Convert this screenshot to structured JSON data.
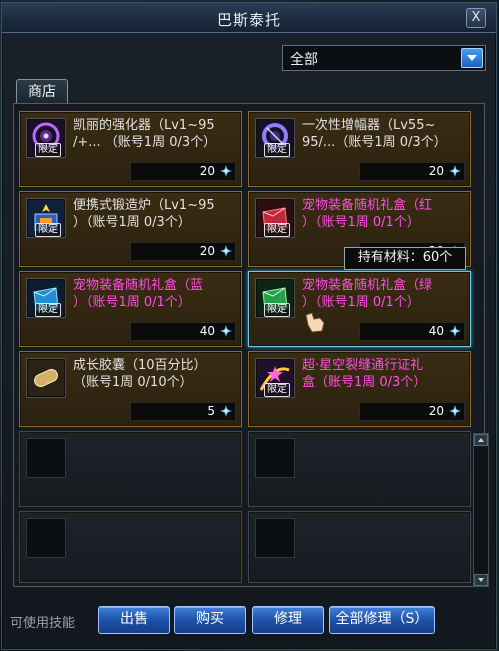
{
  "window": {
    "title": "巴斯泰托",
    "close_label": "X"
  },
  "filter": {
    "selected": "全部"
  },
  "tab": {
    "label": "商店"
  },
  "badge_label": "限定",
  "items": [
    {
      "name_line1": "凯丽的强化器（Lv1~95",
      "name_line2": "/+... （账号1周 0/3个）",
      "price": "20",
      "color": "white",
      "icon": "purple-orb-icon",
      "limited": true
    },
    {
      "name_line1": "一次性增幅器（Lv55~",
      "name_line2": "95/...（账号1周 0/3个）",
      "price": "20",
      "color": "white",
      "icon": "purple-ring-icon",
      "limited": true
    },
    {
      "name_line1": "便携式锻造炉（Lv1~95",
      "name_line2": "）（账号1周 0/3个）",
      "price": "20",
      "color": "white",
      "icon": "forge-icon",
      "limited": true
    },
    {
      "name_line1": "宠物装备随机礼盒（红",
      "name_line2": "）（账号1周 0/1个）",
      "price": "20",
      "color": "pink",
      "icon": "red-gift-box-icon",
      "limited": true
    },
    {
      "name_line1": "宠物装备随机礼盒（蓝",
      "name_line2": "）（账号1周 0/1个）",
      "price": "40",
      "color": "pink",
      "icon": "blue-gift-box-icon",
      "limited": true
    },
    {
      "name_line1": "宠物装备随机礼盒（绿",
      "name_line2": "）（账号1周 0/1个）",
      "price": "40",
      "color": "pink",
      "icon": "green-gift-box-icon",
      "limited": true,
      "selected": true
    },
    {
      "name_line1": "成长胶囊（10百分比）",
      "name_line2": "（账号1周 0/10个）",
      "price": "5",
      "color": "white",
      "icon": "capsule-icon",
      "limited": false
    },
    {
      "name_line1": "超·星空裂缝通行证礼",
      "name_line2": "盒（账号1周 0/3个）",
      "price": "20",
      "color": "pink",
      "icon": "star-pass-icon",
      "limited": true
    }
  ],
  "tooltip": {
    "text": "持有材料：60个"
  },
  "footer": {
    "skill_text": "可使用技能",
    "sell_label": "出售",
    "buy_label": "购买",
    "repair_label": "修理",
    "repair_all_label": "全部修理（S）"
  },
  "colors": {
    "accent": "#3f7fd6",
    "pink_name": "#ff4fe0",
    "gold_border": "#8a6d2a"
  }
}
